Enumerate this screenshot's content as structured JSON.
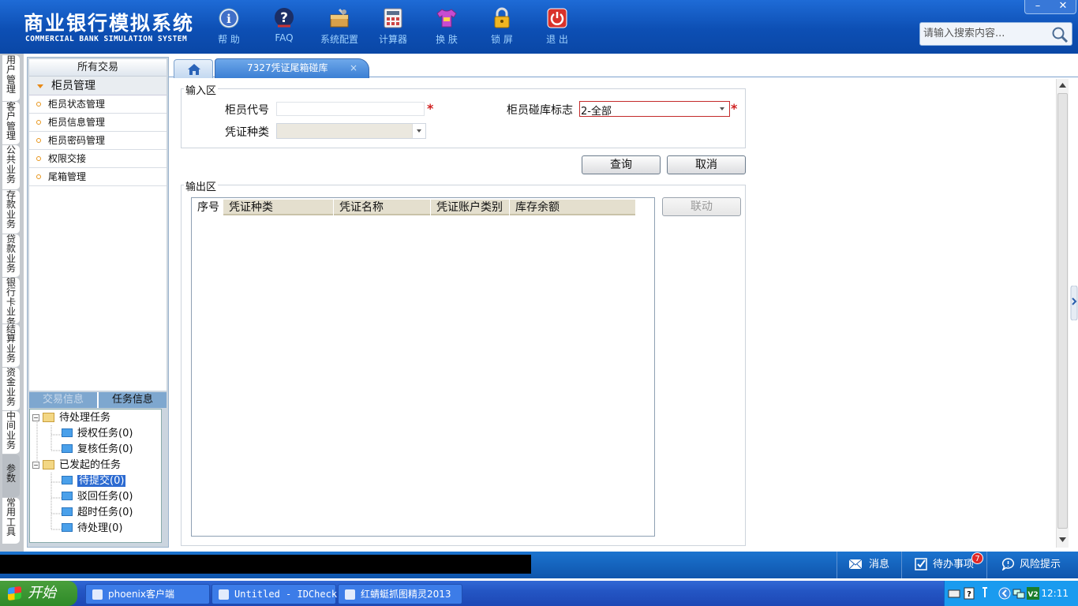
{
  "header": {
    "title_cn": "商业银行模拟系统",
    "title_en": "COMMERCIAL BANK SIMULATION SYSTEM",
    "toolbar": [
      {
        "label": "帮 助",
        "icon": "info-icon"
      },
      {
        "label": "FAQ",
        "icon": "question-icon"
      },
      {
        "label": "系统配置",
        "icon": "config-icon"
      },
      {
        "label": "计算器",
        "icon": "calculator-icon"
      },
      {
        "label": "换 肤",
        "icon": "shirt-icon"
      },
      {
        "label": "锁 屏",
        "icon": "lock-icon"
      },
      {
        "label": "退 出",
        "icon": "power-icon"
      }
    ],
    "window_controls": {
      "minimize": "–",
      "close": "✕"
    },
    "search_placeholder": "请输入搜索内容..."
  },
  "vertical_tabs": [
    "用户管理",
    "客户管理",
    "公共业务",
    "存款业务",
    "贷款业务",
    "银行卡业务",
    "结算业务",
    "资金业务",
    "中间业务",
    "参数",
    "常用工具"
  ],
  "sidebar": {
    "all_transactions": "所有交易",
    "group": "柜员管理",
    "items": [
      "柜员状态管理",
      "柜员信息管理",
      "柜员密码管理",
      "权限交接",
      "尾箱管理"
    ],
    "info_tabs": [
      "交易信息",
      "任务信息"
    ],
    "tree": {
      "pending": "待处理任务",
      "pending_children": [
        "授权任务(0)",
        "复核任务(0)"
      ],
      "initiated": "已发起的任务",
      "initiated_children": [
        "待提交(0)",
        "驳回任务(0)",
        "超时任务(0)",
        "待处理(0)"
      ]
    }
  },
  "tabs": {
    "home_icon": "home-icon",
    "active": "7327凭证尾箱碰库",
    "close": "×"
  },
  "input_area": {
    "legend": "输入区",
    "teller_code_label": "柜员代号",
    "teller_code_value": "",
    "flag_label": "柜员碰库标志",
    "flag_value": "2-全部",
    "voucher_type_label": "凭证种类",
    "voucher_type_value": "",
    "required_mark": "*"
  },
  "buttons": {
    "query": "查询",
    "cancel": "取消",
    "link": "联动"
  },
  "output_area": {
    "legend": "输出区",
    "columns": [
      "序号",
      "凭证种类",
      "凭证名称",
      "凭证账户类别",
      "库存余额"
    ],
    "rows": []
  },
  "status_bar": {
    "message": "消息",
    "todo": "待办事项",
    "todo_count": "7",
    "risk": "风险提示"
  },
  "taskbar": {
    "start": "开始",
    "tasks": [
      "phoenix客户端",
      "Untitled - IDCheck",
      "红蜻蜓抓图精灵2013"
    ],
    "clock": "12:11"
  }
}
